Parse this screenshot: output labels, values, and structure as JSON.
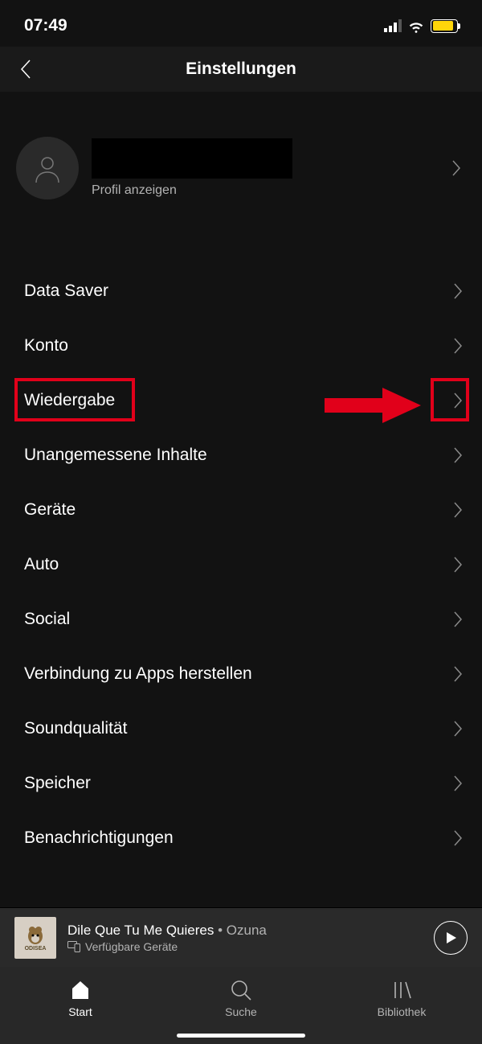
{
  "status": {
    "time": "07:49"
  },
  "header": {
    "title": "Einstellungen"
  },
  "profile": {
    "view_label": "Profil anzeigen"
  },
  "settings": {
    "items": [
      {
        "label": "Data Saver"
      },
      {
        "label": "Konto"
      },
      {
        "label": "Wiedergabe"
      },
      {
        "label": "Unangemessene Inhalte"
      },
      {
        "label": "Geräte"
      },
      {
        "label": "Auto"
      },
      {
        "label": "Social"
      },
      {
        "label": "Verbindung zu Apps herstellen"
      },
      {
        "label": "Soundqualität"
      },
      {
        "label": "Speicher"
      },
      {
        "label": "Benachrichtigungen"
      }
    ]
  },
  "now_playing": {
    "title": "Dile Que Tu Me Quieres",
    "artist": "Ozuna",
    "album_tag": "ODISEA",
    "devices_label": "Verfügbare Geräte"
  },
  "tabs": {
    "start": "Start",
    "search": "Suche",
    "library": "Bibliothek"
  },
  "annotation": {
    "highlight_color": "#e1001a"
  }
}
